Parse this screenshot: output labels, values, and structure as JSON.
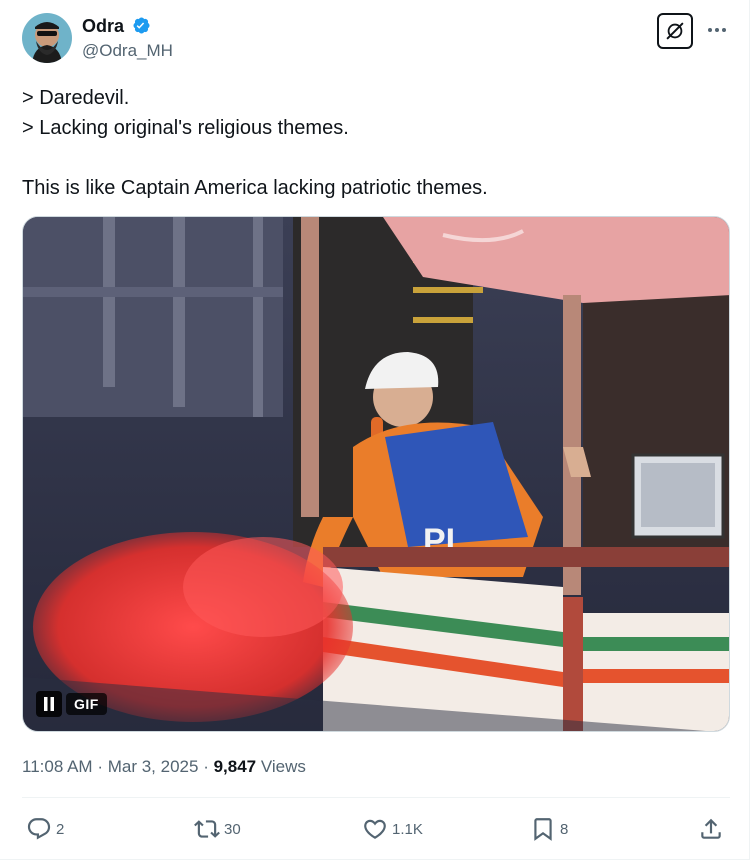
{
  "author": {
    "display_name": "Odra",
    "handle": "@Odra_MH",
    "verified": true
  },
  "tweet": {
    "lines": [
      "> Daredevil.",
      "> Lacking original's religious themes.",
      "",
      "This is like Captain America lacking patriotic themes."
    ]
  },
  "media": {
    "type": "GIF",
    "badge_label": "GIF",
    "playback_state": "playing"
  },
  "meta": {
    "time": "11:08 AM",
    "separator": "·",
    "date": "Mar 3, 2025",
    "views_count": "9,847",
    "views_label": "Views"
  },
  "actions": {
    "replies": "2",
    "reposts": "30",
    "likes": "1.1K",
    "bookmarks": "8"
  },
  "icons": {
    "grok": "grok-icon",
    "more": "more-icon",
    "verified": "verified-badge-icon",
    "reply": "reply-icon",
    "repost": "repost-icon",
    "like": "heart-icon",
    "bookmark": "bookmark-icon",
    "share": "share-icon"
  },
  "colors": {
    "text_primary": "#0f1419",
    "text_secondary": "#536471",
    "verified_blue": "#1d9bf0",
    "border": "#eff3f4"
  }
}
